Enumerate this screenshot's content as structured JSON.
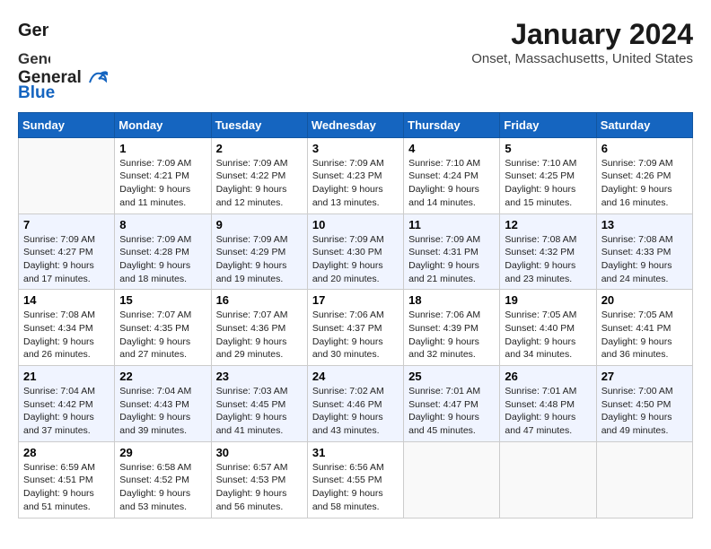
{
  "logo": {
    "name": "General",
    "name2": "Blue"
  },
  "title": "January 2024",
  "subtitle": "Onset, Massachusetts, United States",
  "days_of_week": [
    "Sunday",
    "Monday",
    "Tuesday",
    "Wednesday",
    "Thursday",
    "Friday",
    "Saturday"
  ],
  "weeks": [
    [
      {
        "day": "",
        "info": ""
      },
      {
        "day": "1",
        "info": "Sunrise: 7:09 AM\nSunset: 4:21 PM\nDaylight: 9 hours\nand 11 minutes."
      },
      {
        "day": "2",
        "info": "Sunrise: 7:09 AM\nSunset: 4:22 PM\nDaylight: 9 hours\nand 12 minutes."
      },
      {
        "day": "3",
        "info": "Sunrise: 7:09 AM\nSunset: 4:23 PM\nDaylight: 9 hours\nand 13 minutes."
      },
      {
        "day": "4",
        "info": "Sunrise: 7:10 AM\nSunset: 4:24 PM\nDaylight: 9 hours\nand 14 minutes."
      },
      {
        "day": "5",
        "info": "Sunrise: 7:10 AM\nSunset: 4:25 PM\nDaylight: 9 hours\nand 15 minutes."
      },
      {
        "day": "6",
        "info": "Sunrise: 7:09 AM\nSunset: 4:26 PM\nDaylight: 9 hours\nand 16 minutes."
      }
    ],
    [
      {
        "day": "7",
        "info": "Sunrise: 7:09 AM\nSunset: 4:27 PM\nDaylight: 9 hours\nand 17 minutes."
      },
      {
        "day": "8",
        "info": "Sunrise: 7:09 AM\nSunset: 4:28 PM\nDaylight: 9 hours\nand 18 minutes."
      },
      {
        "day": "9",
        "info": "Sunrise: 7:09 AM\nSunset: 4:29 PM\nDaylight: 9 hours\nand 19 minutes."
      },
      {
        "day": "10",
        "info": "Sunrise: 7:09 AM\nSunset: 4:30 PM\nDaylight: 9 hours\nand 20 minutes."
      },
      {
        "day": "11",
        "info": "Sunrise: 7:09 AM\nSunset: 4:31 PM\nDaylight: 9 hours\nand 21 minutes."
      },
      {
        "day": "12",
        "info": "Sunrise: 7:08 AM\nSunset: 4:32 PM\nDaylight: 9 hours\nand 23 minutes."
      },
      {
        "day": "13",
        "info": "Sunrise: 7:08 AM\nSunset: 4:33 PM\nDaylight: 9 hours\nand 24 minutes."
      }
    ],
    [
      {
        "day": "14",
        "info": "Sunrise: 7:08 AM\nSunset: 4:34 PM\nDaylight: 9 hours\nand 26 minutes."
      },
      {
        "day": "15",
        "info": "Sunrise: 7:07 AM\nSunset: 4:35 PM\nDaylight: 9 hours\nand 27 minutes."
      },
      {
        "day": "16",
        "info": "Sunrise: 7:07 AM\nSunset: 4:36 PM\nDaylight: 9 hours\nand 29 minutes."
      },
      {
        "day": "17",
        "info": "Sunrise: 7:06 AM\nSunset: 4:37 PM\nDaylight: 9 hours\nand 30 minutes."
      },
      {
        "day": "18",
        "info": "Sunrise: 7:06 AM\nSunset: 4:39 PM\nDaylight: 9 hours\nand 32 minutes."
      },
      {
        "day": "19",
        "info": "Sunrise: 7:05 AM\nSunset: 4:40 PM\nDaylight: 9 hours\nand 34 minutes."
      },
      {
        "day": "20",
        "info": "Sunrise: 7:05 AM\nSunset: 4:41 PM\nDaylight: 9 hours\nand 36 minutes."
      }
    ],
    [
      {
        "day": "21",
        "info": "Sunrise: 7:04 AM\nSunset: 4:42 PM\nDaylight: 9 hours\nand 37 minutes."
      },
      {
        "day": "22",
        "info": "Sunrise: 7:04 AM\nSunset: 4:43 PM\nDaylight: 9 hours\nand 39 minutes."
      },
      {
        "day": "23",
        "info": "Sunrise: 7:03 AM\nSunset: 4:45 PM\nDaylight: 9 hours\nand 41 minutes."
      },
      {
        "day": "24",
        "info": "Sunrise: 7:02 AM\nSunset: 4:46 PM\nDaylight: 9 hours\nand 43 minutes."
      },
      {
        "day": "25",
        "info": "Sunrise: 7:01 AM\nSunset: 4:47 PM\nDaylight: 9 hours\nand 45 minutes."
      },
      {
        "day": "26",
        "info": "Sunrise: 7:01 AM\nSunset: 4:48 PM\nDaylight: 9 hours\nand 47 minutes."
      },
      {
        "day": "27",
        "info": "Sunrise: 7:00 AM\nSunset: 4:50 PM\nDaylight: 9 hours\nand 49 minutes."
      }
    ],
    [
      {
        "day": "28",
        "info": "Sunrise: 6:59 AM\nSunset: 4:51 PM\nDaylight: 9 hours\nand 51 minutes."
      },
      {
        "day": "29",
        "info": "Sunrise: 6:58 AM\nSunset: 4:52 PM\nDaylight: 9 hours\nand 53 minutes."
      },
      {
        "day": "30",
        "info": "Sunrise: 6:57 AM\nSunset: 4:53 PM\nDaylight: 9 hours\nand 56 minutes."
      },
      {
        "day": "31",
        "info": "Sunrise: 6:56 AM\nSunset: 4:55 PM\nDaylight: 9 hours\nand 58 minutes."
      },
      {
        "day": "",
        "info": ""
      },
      {
        "day": "",
        "info": ""
      },
      {
        "day": "",
        "info": ""
      }
    ]
  ]
}
